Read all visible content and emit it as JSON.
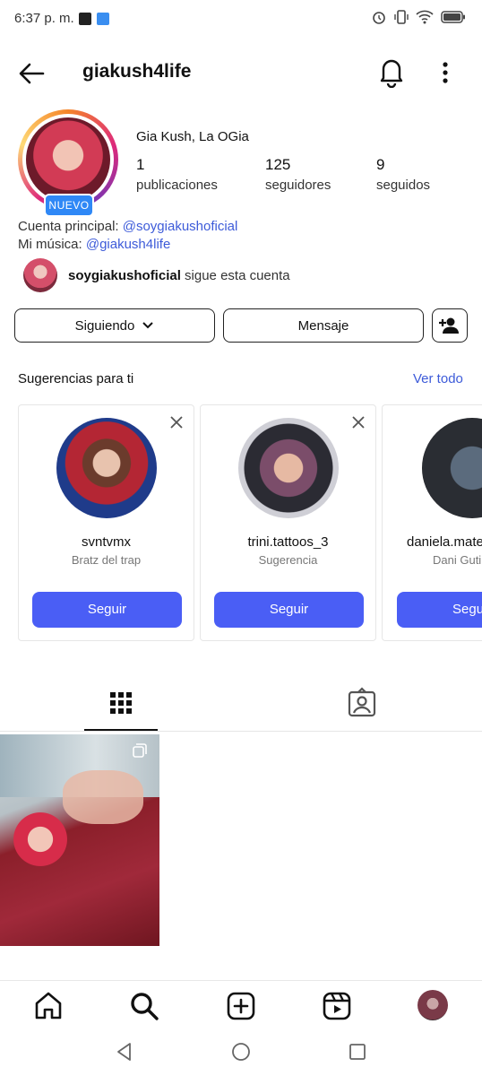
{
  "status_bar": {
    "time": "6:37 p. m."
  },
  "header": {
    "username": "giakush4life"
  },
  "profile": {
    "full_name": "Gia Kush, La OGia",
    "badge": "NUEVO",
    "stats": [
      {
        "value": "1",
        "label": "publicaciones"
      },
      {
        "value": "125",
        "label": "seguidores"
      },
      {
        "value": "9",
        "label": "seguidos"
      }
    ],
    "bio_line1_prefix": "Cuenta principal: ",
    "bio_line1_link": "@soygiakushoficial",
    "bio_line2_prefix": "Mi música: ",
    "bio_line2_link": "@giakush4life",
    "followed_by_user": "soygiakushoficial",
    "followed_by_suffix": " sigue esta cuenta"
  },
  "actions": {
    "following": "Siguiendo",
    "message": "Mensaje"
  },
  "suggestions": {
    "title": "Sugerencias para ti",
    "see_all": "Ver todo",
    "cards": [
      {
        "name": "svntvmx",
        "subtitle": "Bratz del trap",
        "button": "Seguir"
      },
      {
        "name": "trini.tattoos_3",
        "subtitle": "Sugerencia",
        "button": "Seguir"
      },
      {
        "name": "daniela.mate",
        "subtitle": "Dani Guti",
        "button": "Segu"
      }
    ]
  },
  "colors": {
    "link": "#3d5bd9",
    "button": "#4a5ef5",
    "badge": "#2f88f6"
  }
}
